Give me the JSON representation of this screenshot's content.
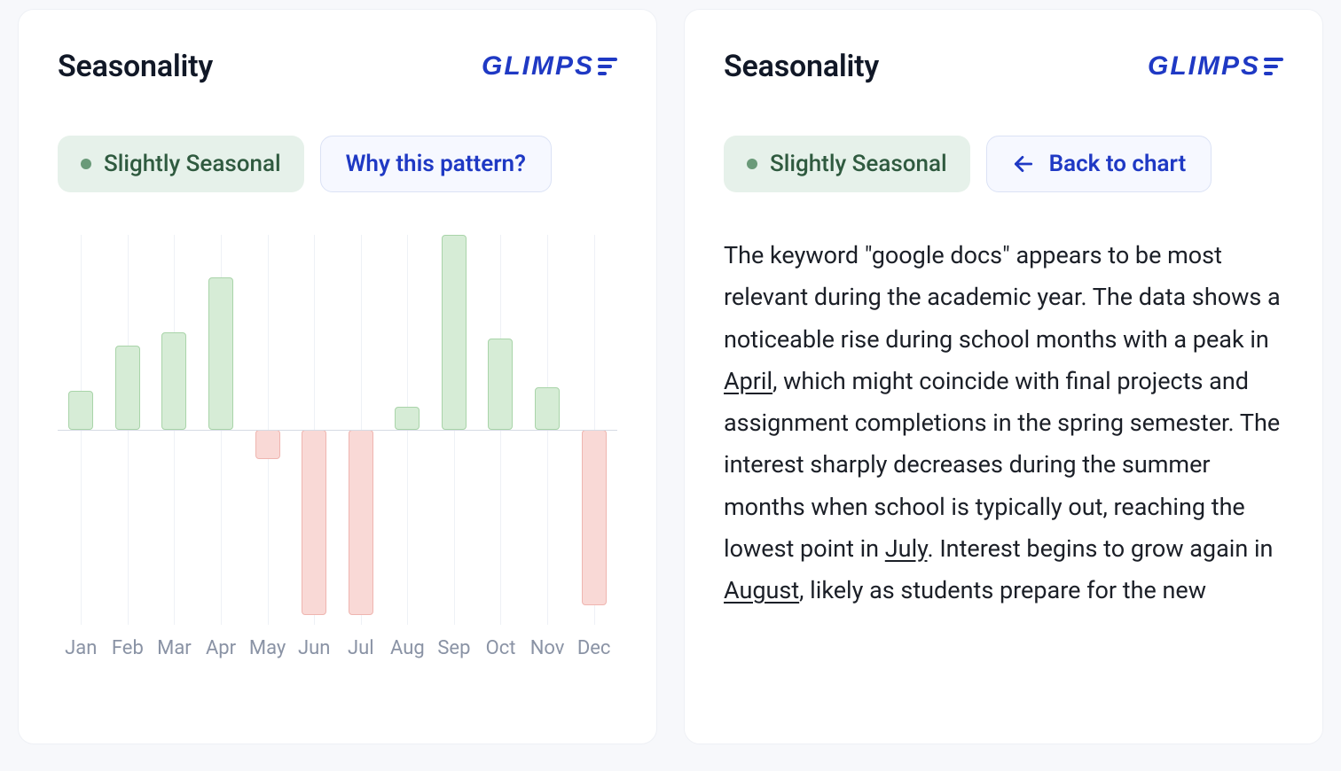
{
  "left": {
    "title": "Seasonality",
    "badge": "Slightly Seasonal",
    "link": "Why this pattern?"
  },
  "right": {
    "title": "Seasonality",
    "badge": "Slightly Seasonal",
    "link": "Back to chart",
    "text_pre": "The keyword \"google docs\" appears to be most relevant during the academic year. The data shows a noticeable rise during school months with a peak in ",
    "u1": "April",
    "text_mid1": ", which might coincide with final projects and assignment completions in the spring semester. The interest sharply decreases during the summer months when school is typically out, reaching the lowest point in ",
    "u2": "July",
    "text_mid2": ". Interest begins to grow again in ",
    "u3": "August",
    "text_post": ", likely as students prepare for the new"
  },
  "brand": "GLIMPS",
  "colors": {
    "brand": "#1f39c4",
    "badge_bg": "#e6f1ea",
    "badge_fg": "#2f5a3f",
    "pos_fill": "#d6ecd6",
    "pos_stroke": "#a9d4a9",
    "neg_fill": "#f9d9d6",
    "neg_stroke": "#efb5b0"
  },
  "chart_data": {
    "type": "bar",
    "title": "Seasonality",
    "xlabel": "",
    "ylabel": "",
    "ylim": [
      -100,
      100
    ],
    "categories": [
      "Jan",
      "Feb",
      "Mar",
      "Apr",
      "May",
      "Jun",
      "Jul",
      "Aug",
      "Sep",
      "Oct",
      "Nov",
      "Dec"
    ],
    "values": [
      20,
      43,
      50,
      78,
      -15,
      -95,
      -95,
      12,
      100,
      47,
      22,
      -90
    ]
  }
}
